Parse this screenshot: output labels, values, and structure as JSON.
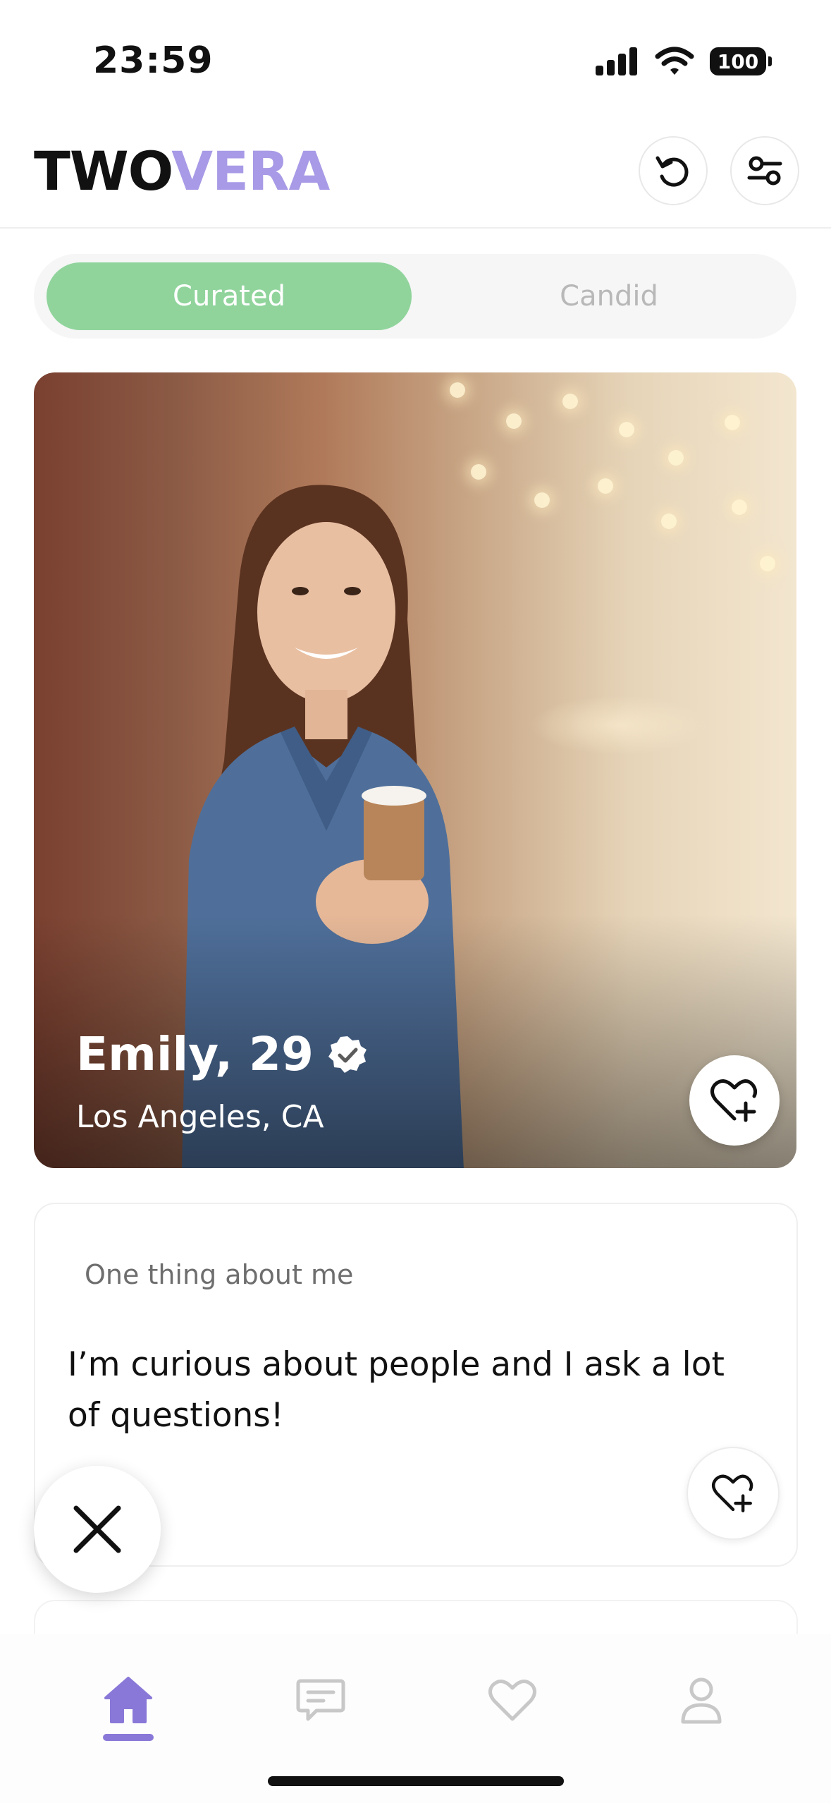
{
  "status_bar": {
    "time": "23:59",
    "battery": "100"
  },
  "header": {
    "logo_part1": "TWO",
    "logo_part2": "VERA",
    "logo_part2_color": "#a89ae6"
  },
  "tabs": {
    "active": "Curated",
    "inactive": "Candid",
    "active_color": "#90d49c"
  },
  "profile": {
    "name": "Emily, 29",
    "location": "Los Angeles, CA",
    "verified": true
  },
  "prompt": {
    "label": "One thing about me",
    "answer": "I’m curious about people and I ask a lot of questions!"
  },
  "nav": {
    "items": [
      "home-icon",
      "chat-icon",
      "heart-icon",
      "profile-icon"
    ],
    "active_index": 0,
    "active_color": "#8a78d8",
    "inactive_color": "#c8c8c8"
  },
  "icons": {
    "undo": "undo-icon",
    "filters": "sliders-icon",
    "like": "heart-plus-icon",
    "pass": "close-icon",
    "verified": "verified-badge-icon"
  }
}
